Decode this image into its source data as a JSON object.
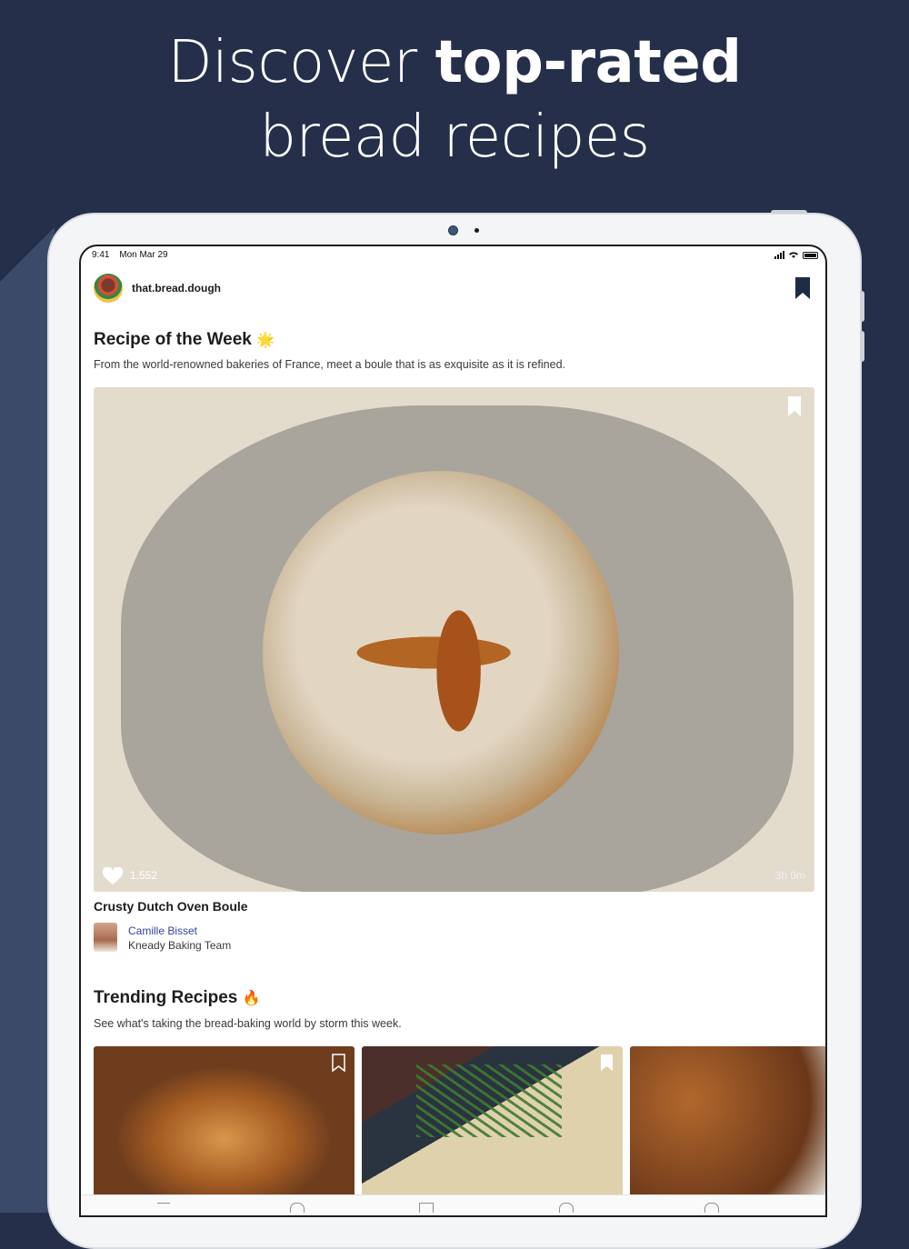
{
  "headline": {
    "line1_prefix": "Discover",
    "line1_bold": "top-rated",
    "line2": "bread recipes"
  },
  "status_bar": {
    "time": "9:41",
    "date": "Mon Mar 29"
  },
  "header": {
    "username": "that.bread.dough"
  },
  "recipe_of_week": {
    "title": "Recipe of the Week",
    "emoji": "🌟",
    "subtitle": "From the world-renowned bakeries of France, meet a boule that is as exquisite as it is refined.",
    "likes": "1,552",
    "duration": "3h 0m",
    "recipe_name": "Crusty Dutch Oven Boule",
    "author": "Camille Bisset",
    "team": "Kneady Baking Team"
  },
  "trending": {
    "title": "Trending Recipes",
    "emoji": "🔥",
    "subtitle": "See what's taking the bread-baking world by storm this week."
  },
  "colors": {
    "background": "#252f4a",
    "author_link": "#3440a0",
    "bookmark": "#1f2a44"
  }
}
